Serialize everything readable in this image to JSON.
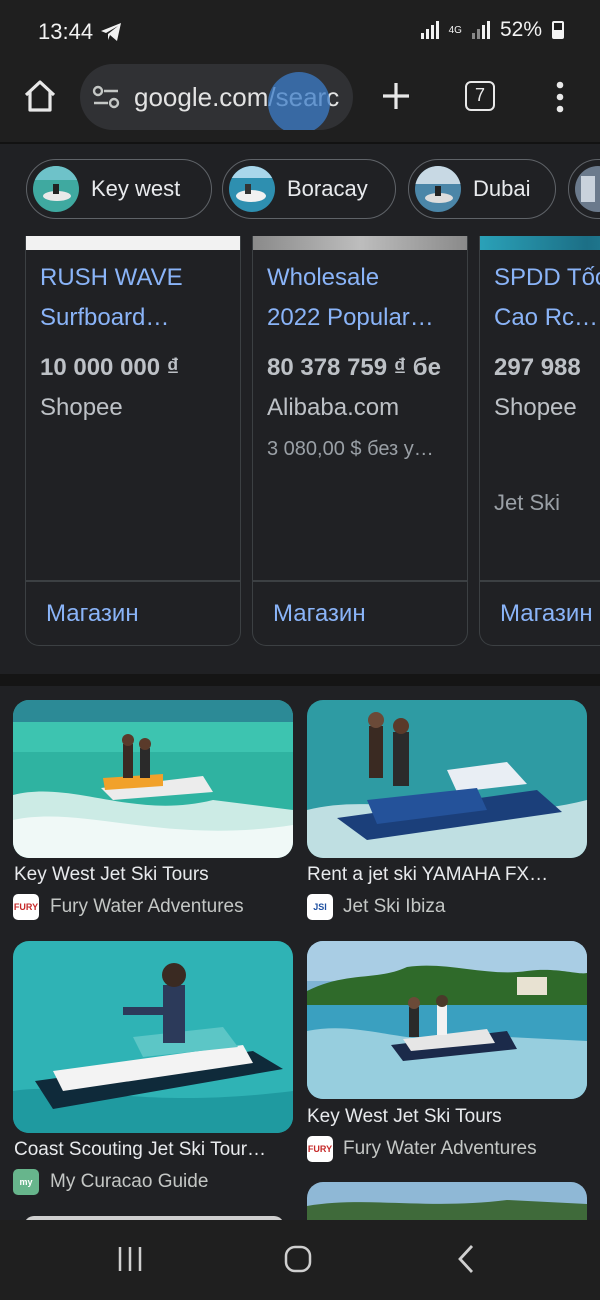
{
  "status_bar": {
    "time": "13:44",
    "network": "4G",
    "battery": "52%",
    "icons": [
      "telegram-icon",
      "signal-icon",
      "battery-icon"
    ]
  },
  "browser": {
    "url": "google.com/searc",
    "tab_count": "7",
    "icons": [
      "home-icon",
      "tune-icon",
      "plus-icon",
      "tabs-icon",
      "more-vert-icon"
    ]
  },
  "chips": [
    {
      "label": "Key west"
    },
    {
      "label": "Boracay"
    },
    {
      "label": "Dubai"
    }
  ],
  "shopping": {
    "cards": [
      {
        "title_line1": "RUSH WAVE",
        "title_line2": "Surfboard…",
        "price": "10 000 000 ₫",
        "store": "Shopee",
        "extra": "",
        "category": "",
        "action": "Магазин"
      },
      {
        "title_line1": "Wholesale",
        "title_line2": "2022 Popular…",
        "price": "80 378 759 ₫ бе",
        "store": "Alibaba.com",
        "extra": "3 080,00 $ без у…",
        "category": "",
        "action": "Магазин"
      },
      {
        "title_line1": "SPDD Tốc",
        "title_line2": "Cao Rc…",
        "price": "297 988",
        "store": "Shopee",
        "extra": "",
        "category": "Jet Ski",
        "action": "Магазин"
      }
    ]
  },
  "image_results": [
    {
      "title": "Key West Jet Ski Tours",
      "source": "Fury Water Adventures",
      "favicon_text": "FURY"
    },
    {
      "title": "Rent a jet ski YAMAHA FX…",
      "source": "Jet Ski Ibiza",
      "favicon_text": "JSI"
    },
    {
      "title": "Coast Scouting Jet Ski Tour…",
      "source": "My Curacao Guide",
      "favicon_text": "my"
    },
    {
      "title": "Key West Jet Ski Tours",
      "source": "Fury Water Adventures",
      "favicon_text": "FURY"
    }
  ],
  "colors": {
    "background": "#1f1f1f",
    "link_blue": "#8ab4f8",
    "water": "#3fb4a4"
  }
}
